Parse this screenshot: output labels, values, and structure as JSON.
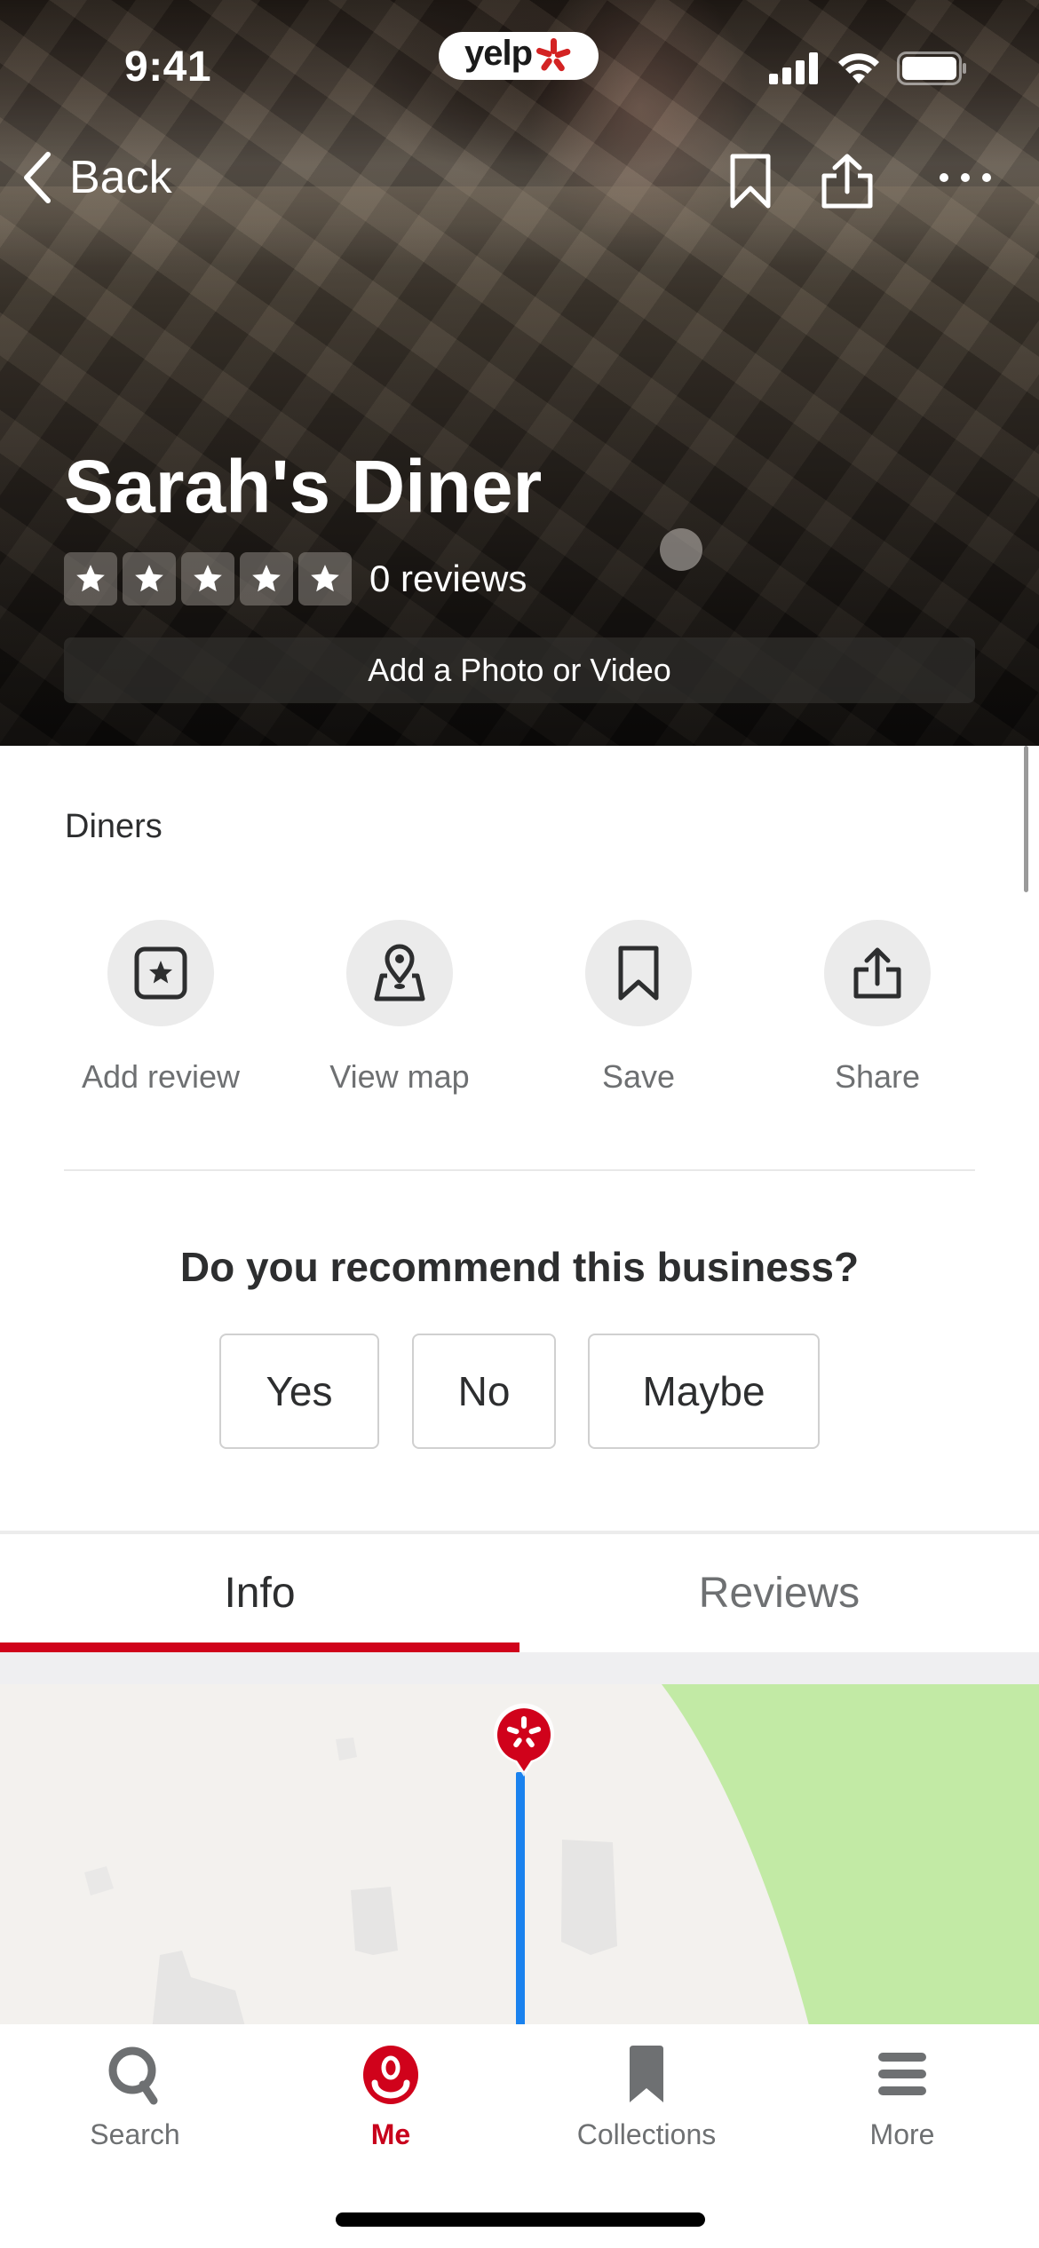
{
  "status_bar": {
    "time": "9:41",
    "app_badge": "yelp"
  },
  "nav": {
    "back_label": "Back",
    "icons": [
      "bookmark-icon",
      "share-icon",
      "more-horizontal-icon"
    ]
  },
  "business": {
    "name": "Sarah's Diner",
    "rating_stars": 0,
    "max_stars": 5,
    "reviews_label": "0 reviews",
    "add_photo_label": "Add a Photo or Video",
    "category": "Diners"
  },
  "actions": [
    {
      "label": "Add review",
      "icon": "star-square-icon"
    },
    {
      "label": "View map",
      "icon": "map-pin-icon"
    },
    {
      "label": "Save",
      "icon": "bookmark-icon"
    },
    {
      "label": "Share",
      "icon": "share-icon"
    }
  ],
  "recommend": {
    "question": "Do you recommend this business?",
    "options": [
      "Yes",
      "No",
      "Maybe"
    ]
  },
  "tabs": {
    "items": [
      "Info",
      "Reviews"
    ],
    "active": "Info"
  },
  "bottom_nav": {
    "items": [
      {
        "label": "Search",
        "icon": "search-icon"
      },
      {
        "label": "Me",
        "icon": "profile-icon"
      },
      {
        "label": "Collections",
        "icon": "bookmark-filled-icon"
      },
      {
        "label": "More",
        "icon": "menu-icon"
      }
    ],
    "active": "Me"
  },
  "colors": {
    "brand_red": "#d0021b",
    "route_blue": "#1a82ee",
    "park_green": "#c2eaa5",
    "map_bg": "#f3f1ee",
    "muted_text": "#6e7072"
  }
}
